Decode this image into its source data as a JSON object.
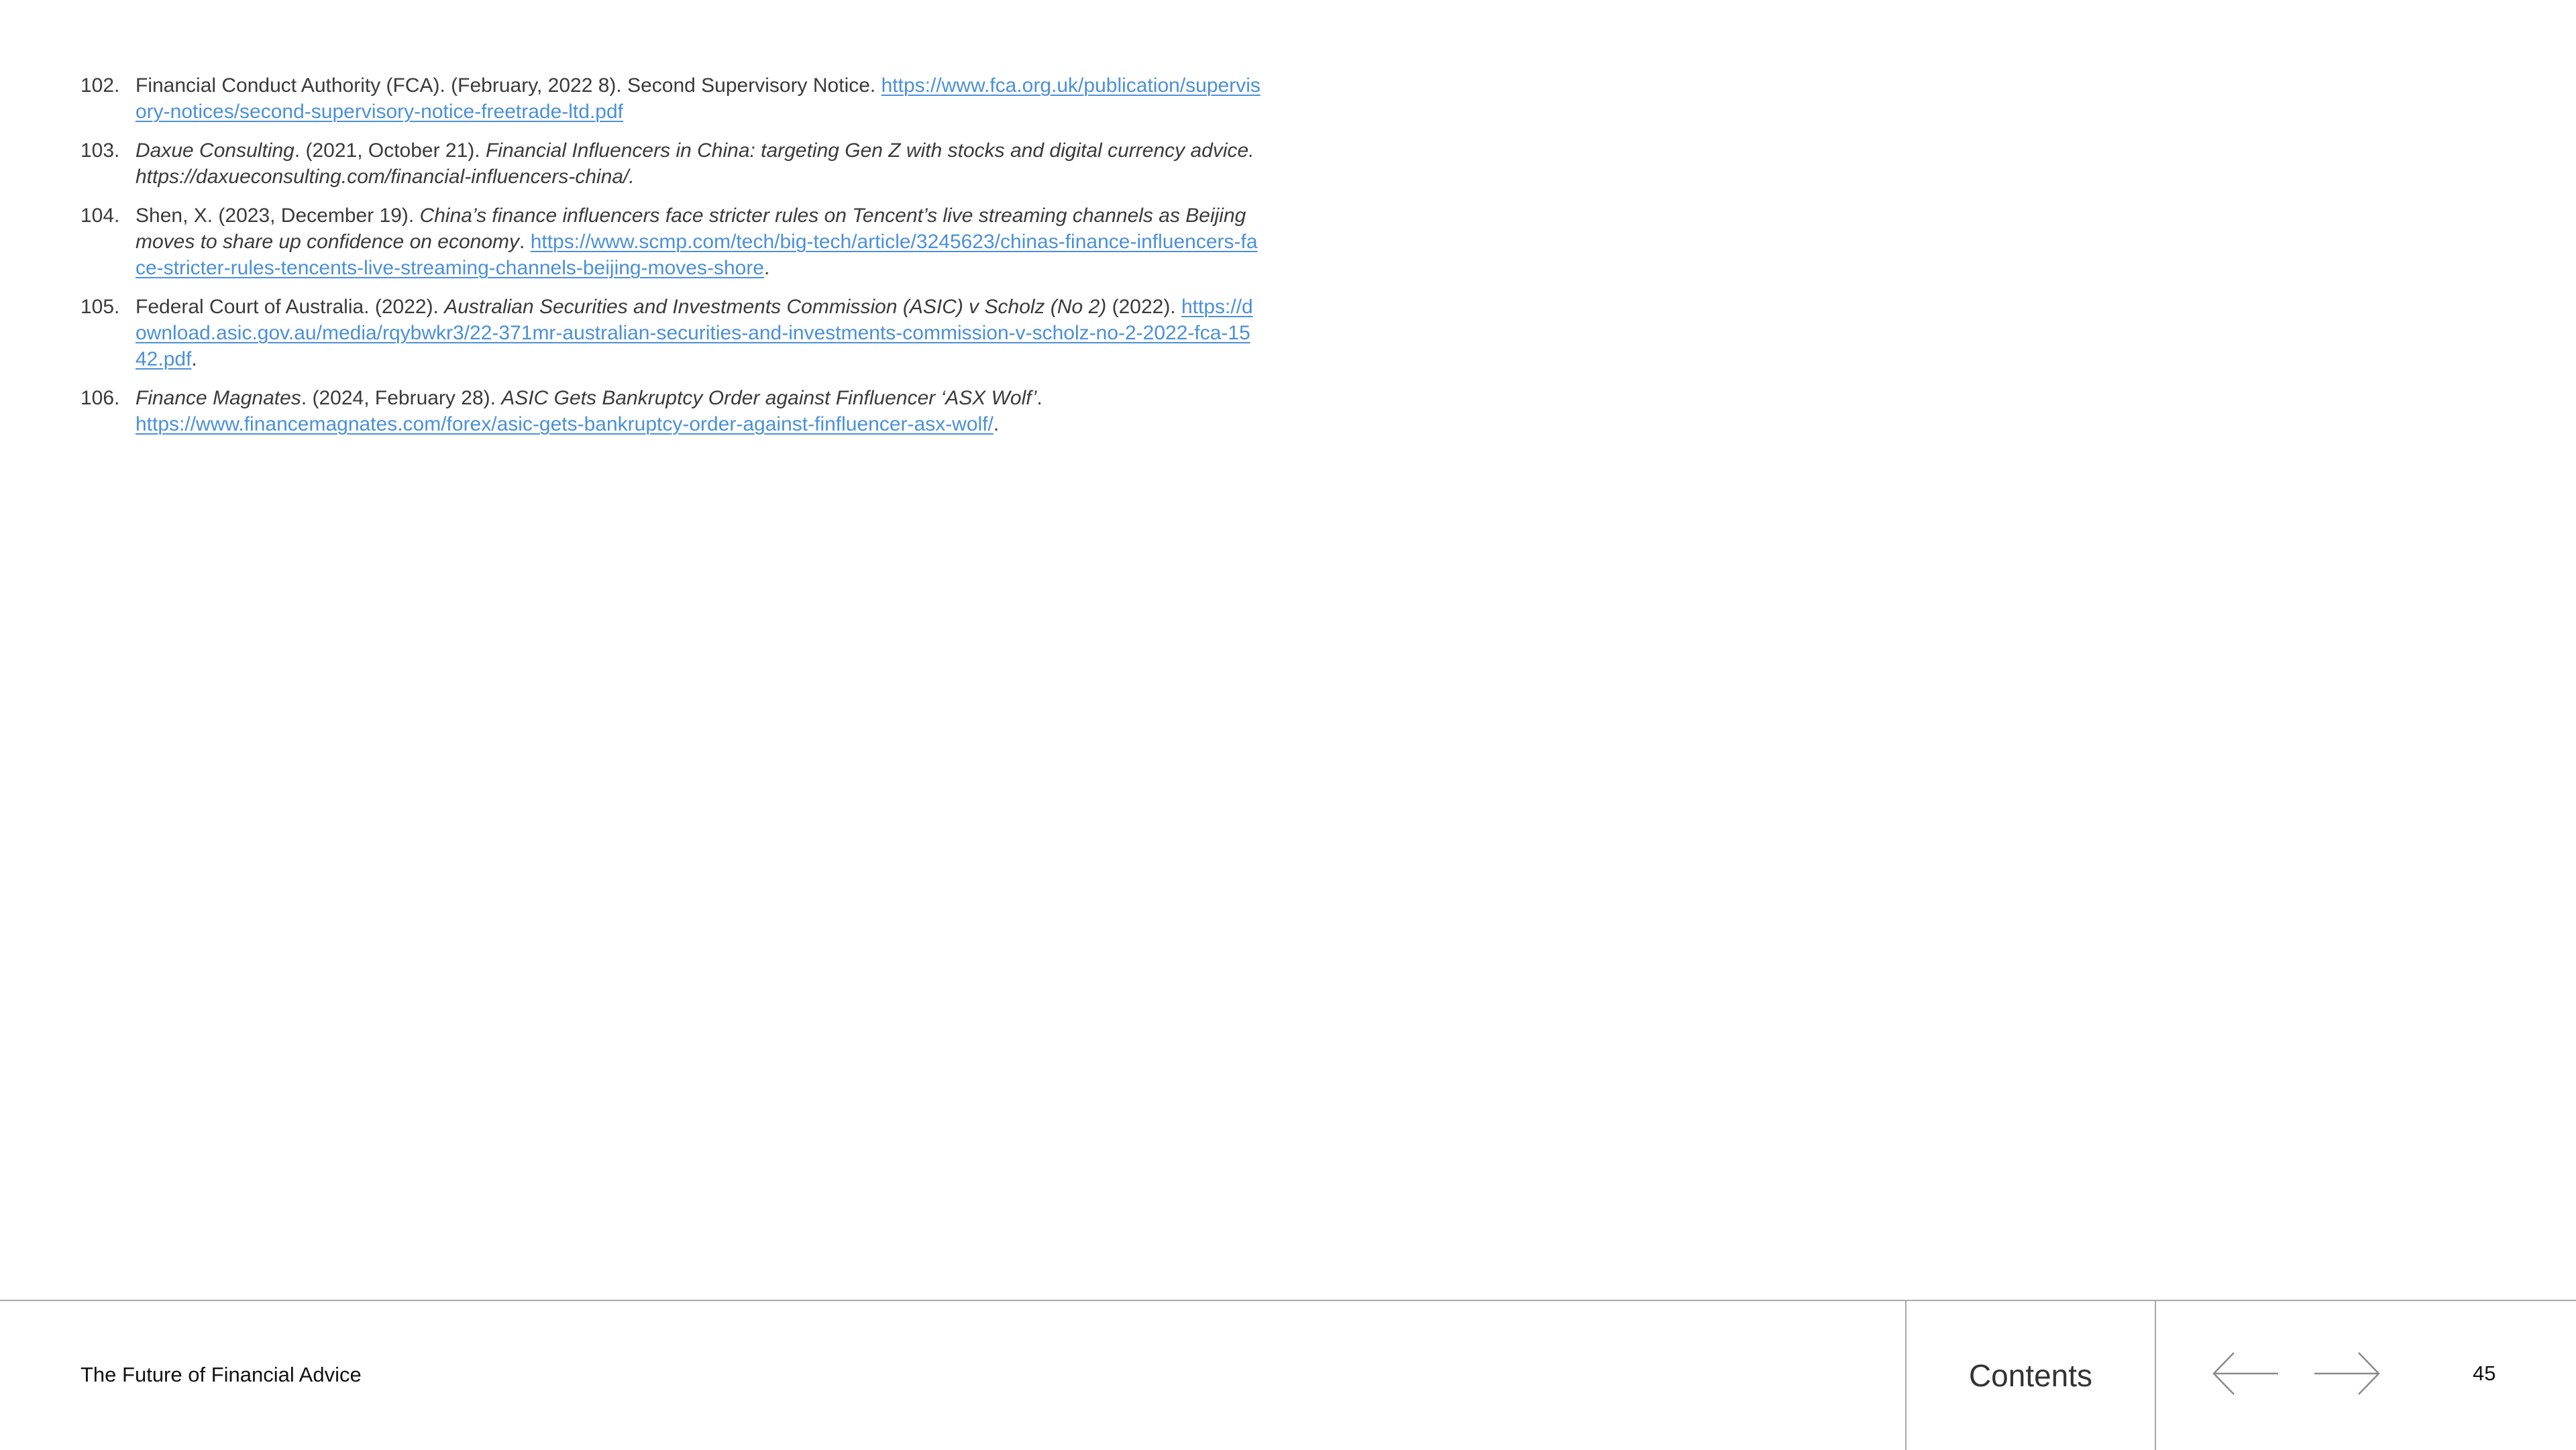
{
  "references": [
    {
      "number": "102.",
      "parts": {
        "a": "Financial Conduct Authority (FCA). (February, 2022 8). Second Supervisory Notice. ",
        "link": "https://www.fca.org.uk/publication/supervisory-notices/second-supervisory-notice-freetrade-ltd.pdf"
      }
    },
    {
      "number": "103.",
      "parts": {
        "a": "Daxue Consulting",
        "b": ". (2021, October 21). ",
        "c": "Financial Influencers in China: targeting Gen Z with stocks and digital currency advice. https://daxueconsulting.com/financial-influencers-china/."
      }
    },
    {
      "number": "104.",
      "parts": {
        "a": "Shen, X. (2023, December 19). ",
        "b": "China’s finance influencers face stricter rules on Tencent’s live streaming channels as Beijing moves to share up confidence on economy",
        "c": ". ",
        "link": "https://www.scmp.com/tech/big-tech/article/3245623/chinas-finance-influencers-face-stricter-rules-tencents-live-streaming-channels-beijing-moves-shore",
        "d": "."
      }
    },
    {
      "number": "105.",
      "parts": {
        "a": "Federal Court of Australia. (2022). ",
        "b": "Australian Securities and Investments Commission (ASIC) v Scholz (No 2)",
        "c": " (2022). ",
        "link": "https://download.asic.gov.au/media/rqybwkr3/22-371mr-australian-securities-and-investments-commission-v-scholz-no-2-2022-fca-1542.pdf",
        "d": "."
      }
    },
    {
      "number": "106.",
      "parts": {
        "a": "Finance Magnates",
        "b": ". (2024, February 28). ",
        "c": "ASIC Gets Bankruptcy Order against Finfluencer ‘ASX Wolf’",
        "d": ". ",
        "link": "https://www.financemagnates.com/forex/asic-gets-bankruptcy-order-against-finfluencer-asx-wolf/",
        "e": "."
      }
    }
  ],
  "footer": {
    "title": "The Future of Financial Advice",
    "contents_label": "Contents",
    "page_number": "45",
    "prev_icon": "arrow-left-icon",
    "next_icon": "arrow-right-icon"
  },
  "colors": {
    "link": "#4a90d9",
    "text": "#3a3a3a",
    "divider": "#a9a9a9"
  }
}
